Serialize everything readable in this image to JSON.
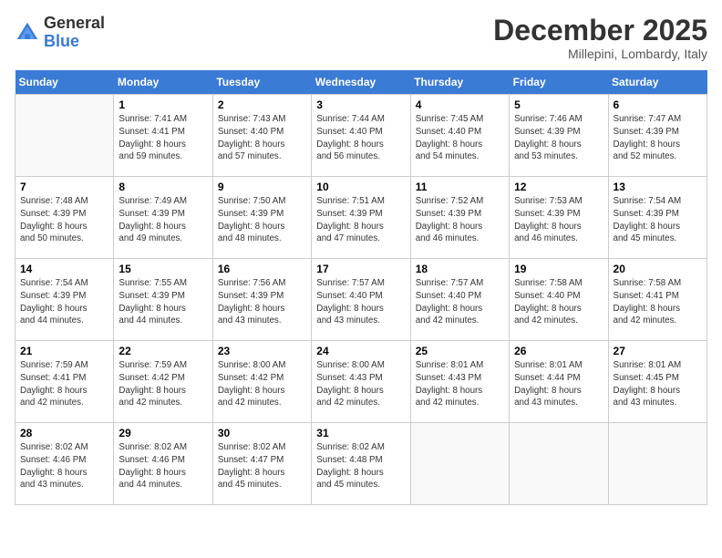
{
  "header": {
    "logo_general": "General",
    "logo_blue": "Blue",
    "month_title": "December 2025",
    "location": "Millepini, Lombardy, Italy"
  },
  "weekdays": [
    "Sunday",
    "Monday",
    "Tuesday",
    "Wednesday",
    "Thursday",
    "Friday",
    "Saturday"
  ],
  "weeks": [
    [
      {
        "day": "",
        "info": ""
      },
      {
        "day": "1",
        "info": "Sunrise: 7:41 AM\nSunset: 4:41 PM\nDaylight: 8 hours\nand 59 minutes."
      },
      {
        "day": "2",
        "info": "Sunrise: 7:43 AM\nSunset: 4:40 PM\nDaylight: 8 hours\nand 57 minutes."
      },
      {
        "day": "3",
        "info": "Sunrise: 7:44 AM\nSunset: 4:40 PM\nDaylight: 8 hours\nand 56 minutes."
      },
      {
        "day": "4",
        "info": "Sunrise: 7:45 AM\nSunset: 4:40 PM\nDaylight: 8 hours\nand 54 minutes."
      },
      {
        "day": "5",
        "info": "Sunrise: 7:46 AM\nSunset: 4:39 PM\nDaylight: 8 hours\nand 53 minutes."
      },
      {
        "day": "6",
        "info": "Sunrise: 7:47 AM\nSunset: 4:39 PM\nDaylight: 8 hours\nand 52 minutes."
      }
    ],
    [
      {
        "day": "7",
        "info": "Sunrise: 7:48 AM\nSunset: 4:39 PM\nDaylight: 8 hours\nand 50 minutes."
      },
      {
        "day": "8",
        "info": "Sunrise: 7:49 AM\nSunset: 4:39 PM\nDaylight: 8 hours\nand 49 minutes."
      },
      {
        "day": "9",
        "info": "Sunrise: 7:50 AM\nSunset: 4:39 PM\nDaylight: 8 hours\nand 48 minutes."
      },
      {
        "day": "10",
        "info": "Sunrise: 7:51 AM\nSunset: 4:39 PM\nDaylight: 8 hours\nand 47 minutes."
      },
      {
        "day": "11",
        "info": "Sunrise: 7:52 AM\nSunset: 4:39 PM\nDaylight: 8 hours\nand 46 minutes."
      },
      {
        "day": "12",
        "info": "Sunrise: 7:53 AM\nSunset: 4:39 PM\nDaylight: 8 hours\nand 46 minutes."
      },
      {
        "day": "13",
        "info": "Sunrise: 7:54 AM\nSunset: 4:39 PM\nDaylight: 8 hours\nand 45 minutes."
      }
    ],
    [
      {
        "day": "14",
        "info": "Sunrise: 7:54 AM\nSunset: 4:39 PM\nDaylight: 8 hours\nand 44 minutes."
      },
      {
        "day": "15",
        "info": "Sunrise: 7:55 AM\nSunset: 4:39 PM\nDaylight: 8 hours\nand 44 minutes."
      },
      {
        "day": "16",
        "info": "Sunrise: 7:56 AM\nSunset: 4:39 PM\nDaylight: 8 hours\nand 43 minutes."
      },
      {
        "day": "17",
        "info": "Sunrise: 7:57 AM\nSunset: 4:40 PM\nDaylight: 8 hours\nand 43 minutes."
      },
      {
        "day": "18",
        "info": "Sunrise: 7:57 AM\nSunset: 4:40 PM\nDaylight: 8 hours\nand 42 minutes."
      },
      {
        "day": "19",
        "info": "Sunrise: 7:58 AM\nSunset: 4:40 PM\nDaylight: 8 hours\nand 42 minutes."
      },
      {
        "day": "20",
        "info": "Sunrise: 7:58 AM\nSunset: 4:41 PM\nDaylight: 8 hours\nand 42 minutes."
      }
    ],
    [
      {
        "day": "21",
        "info": "Sunrise: 7:59 AM\nSunset: 4:41 PM\nDaylight: 8 hours\nand 42 minutes."
      },
      {
        "day": "22",
        "info": "Sunrise: 7:59 AM\nSunset: 4:42 PM\nDaylight: 8 hours\nand 42 minutes."
      },
      {
        "day": "23",
        "info": "Sunrise: 8:00 AM\nSunset: 4:42 PM\nDaylight: 8 hours\nand 42 minutes."
      },
      {
        "day": "24",
        "info": "Sunrise: 8:00 AM\nSunset: 4:43 PM\nDaylight: 8 hours\nand 42 minutes."
      },
      {
        "day": "25",
        "info": "Sunrise: 8:01 AM\nSunset: 4:43 PM\nDaylight: 8 hours\nand 42 minutes."
      },
      {
        "day": "26",
        "info": "Sunrise: 8:01 AM\nSunset: 4:44 PM\nDaylight: 8 hours\nand 43 minutes."
      },
      {
        "day": "27",
        "info": "Sunrise: 8:01 AM\nSunset: 4:45 PM\nDaylight: 8 hours\nand 43 minutes."
      }
    ],
    [
      {
        "day": "28",
        "info": "Sunrise: 8:02 AM\nSunset: 4:46 PM\nDaylight: 8 hours\nand 43 minutes."
      },
      {
        "day": "29",
        "info": "Sunrise: 8:02 AM\nSunset: 4:46 PM\nDaylight: 8 hours\nand 44 minutes."
      },
      {
        "day": "30",
        "info": "Sunrise: 8:02 AM\nSunset: 4:47 PM\nDaylight: 8 hours\nand 45 minutes."
      },
      {
        "day": "31",
        "info": "Sunrise: 8:02 AM\nSunset: 4:48 PM\nDaylight: 8 hours\nand 45 minutes."
      },
      {
        "day": "",
        "info": ""
      },
      {
        "day": "",
        "info": ""
      },
      {
        "day": "",
        "info": ""
      }
    ]
  ]
}
